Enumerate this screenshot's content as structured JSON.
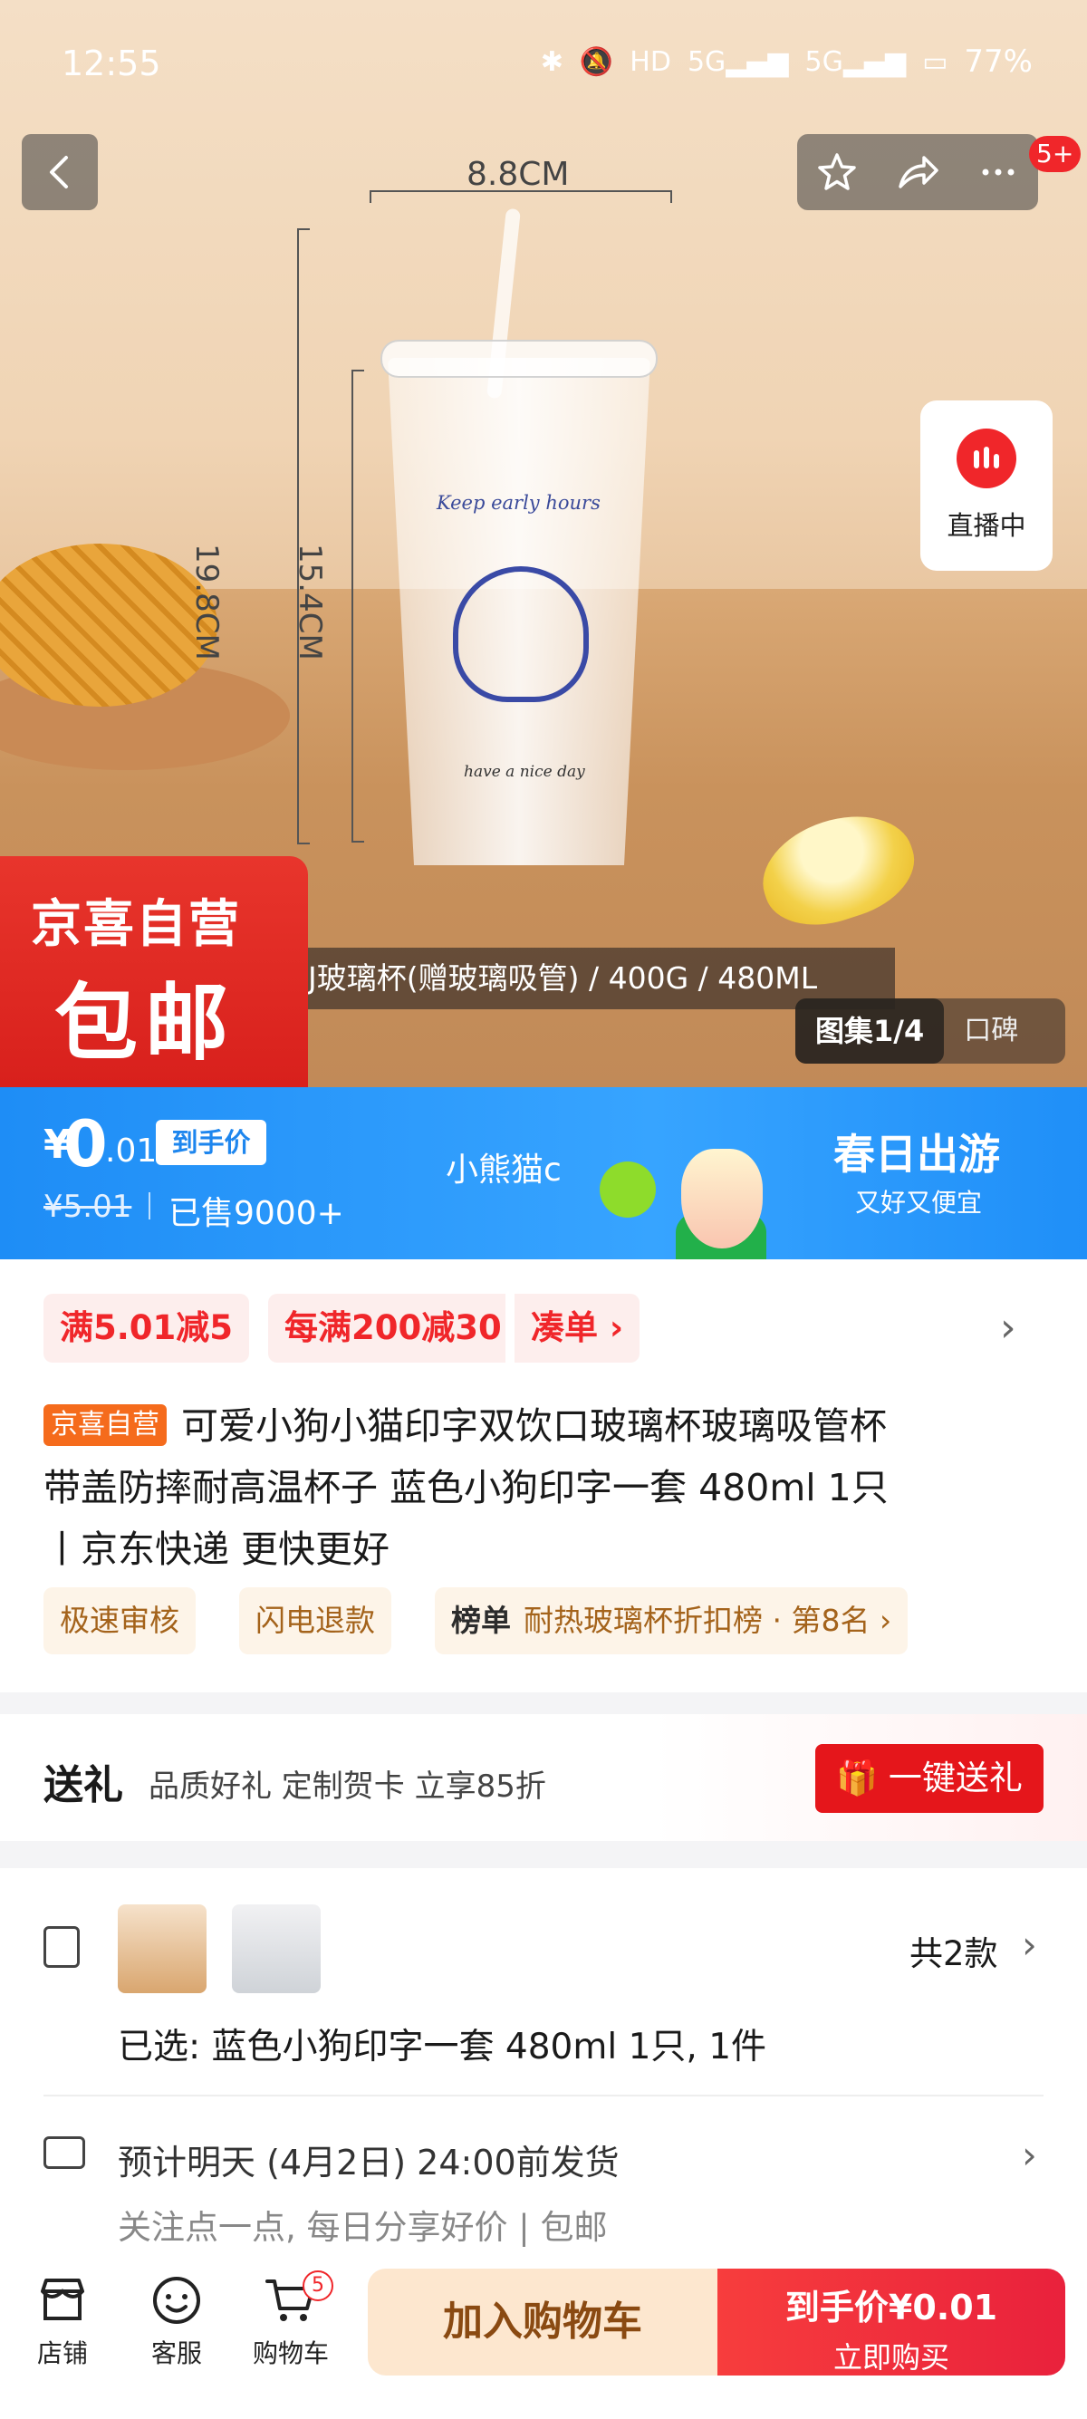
{
  "status_bar": {
    "time": "12:55",
    "battery": "77%"
  },
  "top_actions": {
    "badge": "5+"
  },
  "hero": {
    "dim_width": "8.8CM",
    "dim_height_total": "19.8CM",
    "dim_height_body": "15.4CM",
    "glass_text_top": "Keep early hours",
    "glass_text_bottom": "have a nice day",
    "spec_strip": "J玻璃杯(赠玻璃吸管) / 400G / 480ML",
    "badge_line1": "京喜自营",
    "badge_line2": "包邮",
    "live_label": "直播中",
    "gallery_tab": "图集1/4",
    "review_tab": "口碑"
  },
  "price_bar": {
    "currency": "¥",
    "price_int": "0",
    "price_dec": ".01",
    "price_tag": "到手价",
    "original_price": "¥5.01",
    "sold": "已售9000+",
    "promo_text": "小熊猫c",
    "banner_title": "春日出游",
    "banner_sub": "又好又便宜"
  },
  "coupons": [
    {
      "label": "满5.01减5"
    },
    {
      "label": "每满200减30"
    },
    {
      "label": "凑单 ›"
    }
  ],
  "product": {
    "title_tag": "京喜自营",
    "title_line1": "可爱小狗小猫印字双饮口玻璃杯玻璃吸管杯",
    "title_line2": "带盖防摔耐高温杯子 蓝色小狗印字一套 480ml 1只",
    "title_line3": "丨京东快递 更快更好"
  },
  "chips": {
    "chip1": "极速审核",
    "chip2": "闪电退款",
    "rank_label": "榜单",
    "rank_value": "耐热玻璃杯折扣榜 · 第8名 ›"
  },
  "gift": {
    "title": "送礼",
    "subtitle": "品质好礼 定制贺卡 立享85折",
    "button": "一键送礼"
  },
  "variant": {
    "count": "共2款",
    "selected": "已选: 蓝色小狗印字一套 480ml 1只, 1件"
  },
  "shipping": {
    "main": "预计明天 (4月2日) 24:00前发货",
    "sub": "关注点一点, 每日分享好价 | 包邮"
  },
  "bottom_bar": {
    "store": "店铺",
    "service": "客服",
    "cart": "购物车",
    "cart_badge": "5",
    "add_cart": "加入购物车",
    "buy_line1": "到手价¥0.01",
    "buy_line2": "立即购买"
  },
  "colors": {
    "accent_red": "#f0262a",
    "accent_blue": "#1e8df6",
    "jd_orange": "#f56b1c"
  }
}
